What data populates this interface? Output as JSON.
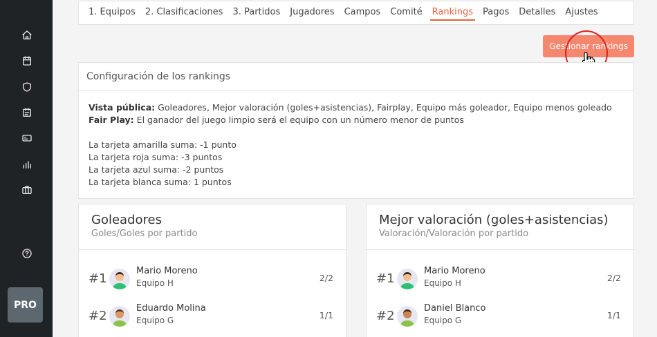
{
  "sidebar": {
    "icons": [
      "home-icon",
      "calendar-icon",
      "shield-icon",
      "id-card-icon",
      "ticket-icon",
      "bar-chart-icon",
      "briefcase-icon",
      "help-icon"
    ],
    "pro_label": "PRO"
  },
  "tabs": [
    {
      "label": "1. Equipos"
    },
    {
      "label": "2. Clasificaciones"
    },
    {
      "label": "3. Partidos"
    },
    {
      "label": "Jugadores"
    },
    {
      "label": "Campos"
    },
    {
      "label": "Comité"
    },
    {
      "label": "Rankings",
      "active": true
    },
    {
      "label": "Pagos"
    },
    {
      "label": "Detalles"
    },
    {
      "label": "Ajustes"
    }
  ],
  "manage_button": "Gestionar rankings",
  "config": {
    "title": "Configuración de los rankings",
    "vista_label": "Vista pública:",
    "vista_value": "Goleadores, Mejor valoración (goles+asistencias), Fairplay, Equipo más goleador, Equipo menos goleado",
    "fair_label": "Fair Play:",
    "fair_value": "El ganador del juego limpio será el equipo con un número menor de puntos",
    "cards": [
      "La tarjeta amarilla suma: -1 punto",
      "La tarjeta roja suma: -3 puntos",
      "La tarjeta azul suma: -2 puntos",
      "La tarjeta blanca suma: 1 puntos"
    ]
  },
  "rankings": [
    {
      "title": "Goleadores",
      "subtitle": "Goles/Goles por partido",
      "rows": [
        {
          "rank": "#1",
          "name": "Mario Moreno",
          "team": "Equipo H",
          "score": "2/2",
          "shirt": "#2fbf71"
        },
        {
          "rank": "#2",
          "name": "Eduardo Molina",
          "team": "Equipo G",
          "score": "1/1",
          "shirt": "#8bc34a"
        }
      ]
    },
    {
      "title": "Mejor valoración (goles+asistencias)",
      "subtitle": "Valoración/Valoración por partido",
      "rows": [
        {
          "rank": "#1",
          "name": "Mario Moreno",
          "team": "Equipo H",
          "score": "2/2",
          "shirt": "#2fbf71"
        },
        {
          "rank": "#2",
          "name": "Daniel Blanco",
          "team": "Equipo G",
          "score": "1/1",
          "shirt": "#8bc34a"
        }
      ]
    }
  ],
  "colors": {
    "accent": "#e8603c",
    "button": "#f5876e",
    "sidebar": "#1f2326"
  }
}
